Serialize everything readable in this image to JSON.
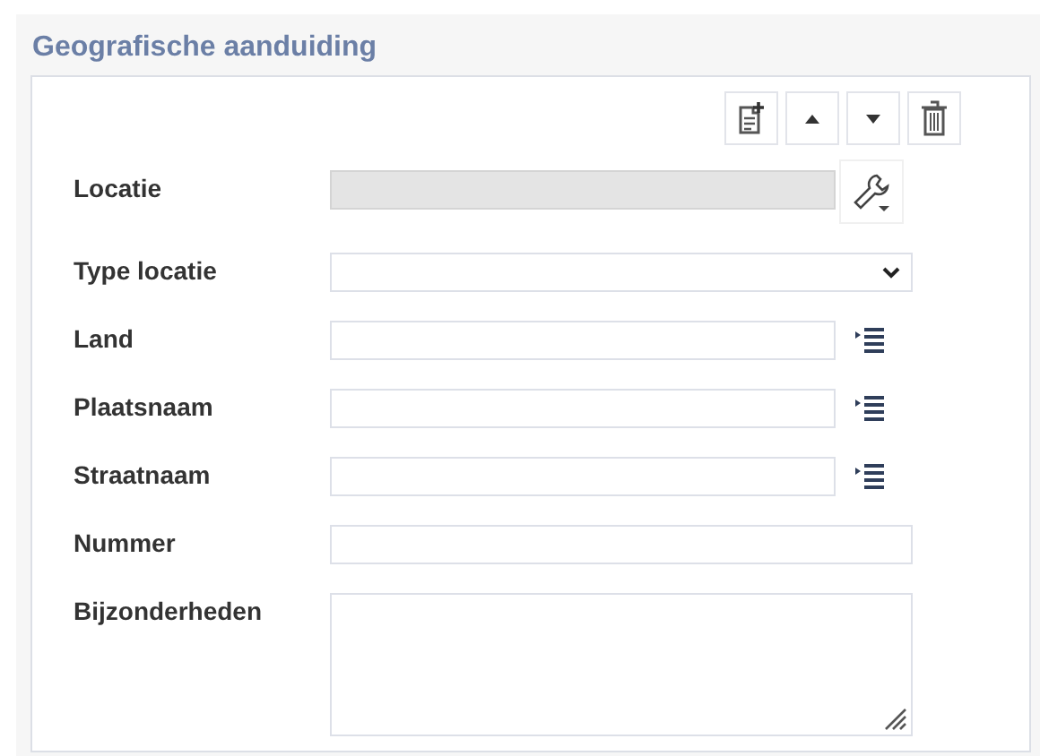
{
  "section": {
    "title": "Geografische aanduiding"
  },
  "fields": [
    {
      "label": "Locatie",
      "kind": "lookup",
      "disabled": true
    },
    {
      "label": "Type locatie",
      "kind": "select",
      "disabled": false
    },
    {
      "label": "Land",
      "kind": "list",
      "disabled": false
    },
    {
      "label": "Plaatsnaam",
      "kind": "list",
      "disabled": false
    },
    {
      "label": "Straatnaam",
      "kind": "list",
      "disabled": false
    },
    {
      "label": "Nummer",
      "kind": "text",
      "disabled": false
    },
    {
      "label": "Bijzonderheden",
      "kind": "textarea",
      "disabled": false
    }
  ]
}
